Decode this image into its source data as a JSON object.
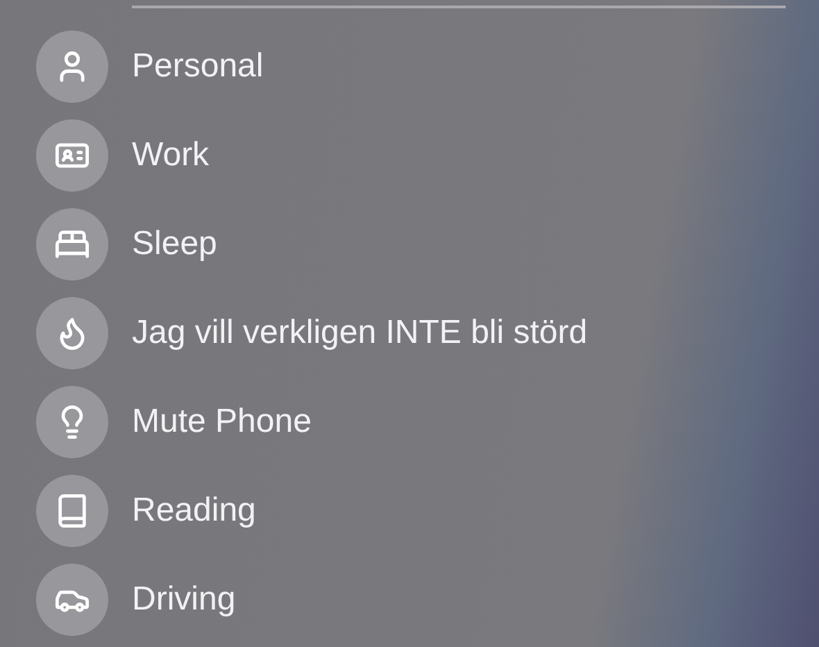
{
  "focus_modes": [
    {
      "label": "Personal",
      "kind": "person"
    },
    {
      "label": "Work",
      "kind": "badge"
    },
    {
      "label": "Sleep",
      "kind": "bed"
    },
    {
      "label": "Jag vill verkligen INTE bli störd",
      "kind": "flame"
    },
    {
      "label": "Mute Phone",
      "kind": "bulb"
    },
    {
      "label": "Reading",
      "kind": "book"
    },
    {
      "label": "Driving",
      "kind": "car"
    }
  ]
}
